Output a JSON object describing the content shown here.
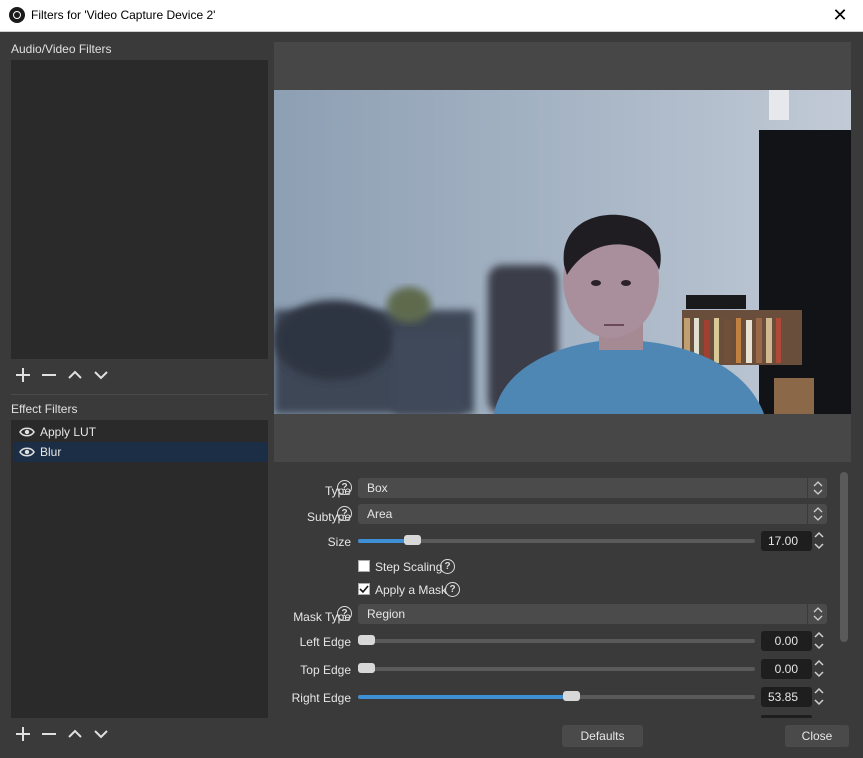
{
  "window": {
    "title": "Filters for 'Video Capture Device 2'",
    "close_glyph": "✕"
  },
  "audio_video": {
    "label": "Audio/Video Filters",
    "items": []
  },
  "effect": {
    "label": "Effect Filters",
    "items": [
      {
        "label": "Apply LUT",
        "selected": false
      },
      {
        "label": "Blur",
        "selected": true
      }
    ]
  },
  "properties": {
    "type": {
      "label": "Type",
      "value": "Box"
    },
    "subtype": {
      "label": "Subtype",
      "value": "Area"
    },
    "size": {
      "label": "Size",
      "value": "17.00",
      "fraction": 0.12
    },
    "step_scaling": {
      "label": "Step Scaling",
      "checked": false
    },
    "apply_mask": {
      "label": "Apply a Mask",
      "checked": true
    },
    "mask_type": {
      "label": "Mask Type",
      "value": "Region"
    },
    "left_edge": {
      "label": "Left Edge",
      "value": "0.00",
      "fraction": 0.0
    },
    "top_edge": {
      "label": "Top Edge",
      "value": "0.00",
      "fraction": 0.0
    },
    "right_edge": {
      "label": "Right Edge",
      "value": "53.85",
      "fraction": 0.5385
    },
    "help_glyph": "?"
  },
  "buttons": {
    "defaults": "Defaults",
    "close": "Close"
  },
  "colors": {
    "accent": "#3f8fd4",
    "selection": "#1c2e46",
    "panel": "#2a2a2a",
    "window": "#3a3a3a"
  }
}
